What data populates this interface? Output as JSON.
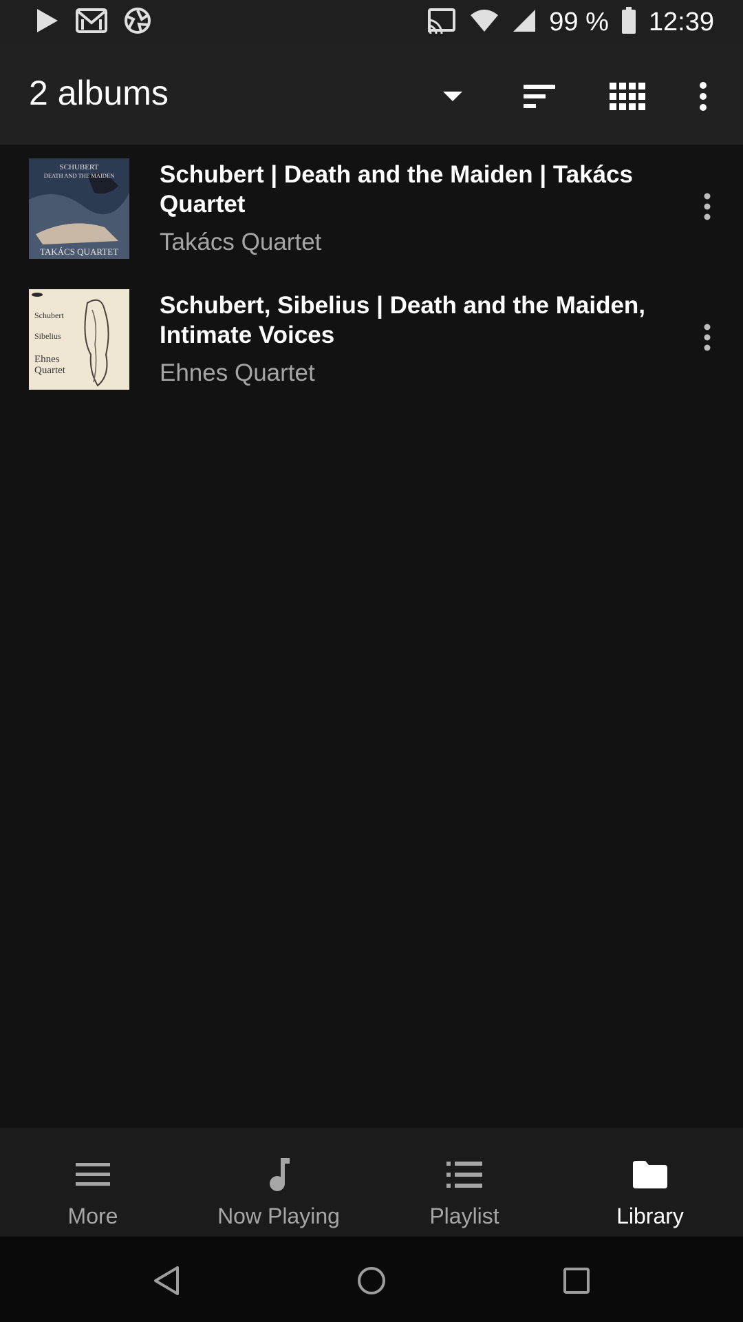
{
  "status_bar": {
    "battery": "99 %",
    "time": "12:39",
    "icons": [
      "play-icon",
      "gmail-icon",
      "camera-aperture-icon",
      "cast-icon",
      "wifi-icon",
      "cell-signal-icon",
      "battery-icon"
    ]
  },
  "app_bar": {
    "title": "2 albums",
    "icons": [
      "dropdown-arrow-icon",
      "sort-icon",
      "grid-view-icon",
      "overflow-menu-icon"
    ]
  },
  "albums": [
    {
      "title": "Schubert | Death and the Maiden | Takács Quartet",
      "artist": "Takács Quartet",
      "art_text_top1": "SCHUBERT",
      "art_text_top2": "DEATH AND THE MAIDEN",
      "art_text_bottom": "TAKÁCS QUARTET",
      "art_color": "#2c3a52"
    },
    {
      "title": "Schubert, Sibelius | Death and the Maiden, Intimate Voices",
      "artist": "Ehnes Quartet",
      "art_text_1": "Schubert",
      "art_text_2": "Sibelius",
      "art_text_3": "Ehnes",
      "art_text_4": "Quartet",
      "art_color": "#efe6d4"
    }
  ],
  "bottom_nav": {
    "items": [
      {
        "label": "More",
        "icon": "hamburger-icon"
      },
      {
        "label": "Now Playing",
        "icon": "music-note-icon"
      },
      {
        "label": "Playlist",
        "icon": "list-icon"
      },
      {
        "label": "Library",
        "icon": "folder-icon"
      }
    ],
    "active": "Library"
  },
  "system_nav": {
    "icons": [
      "back-icon",
      "home-icon",
      "recents-icon"
    ]
  }
}
